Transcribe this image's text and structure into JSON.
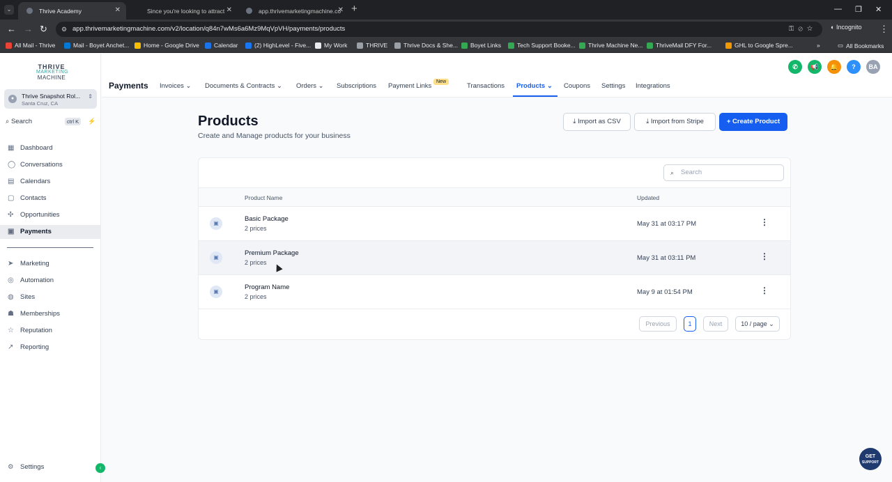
{
  "browser": {
    "tabs": [
      {
        "label": "Thrive Academy"
      },
      {
        "label": "Since you're looking to attract"
      },
      {
        "label": "app.thrivemarketingmachine.co"
      }
    ],
    "new_tab": "+",
    "url": "app.thrivemarketingmachine.com/v2/location/q84n7wMs6a6Mz9MqVpVH/payments/products",
    "incognito_label": "Incognito",
    "bookmarks": [
      {
        "label": "All Mail - Thrive",
        "color": "#ea4335"
      },
      {
        "label": "Mail - Boyet Anchet...",
        "color": "#0078d4"
      },
      {
        "label": "Home - Google Drive",
        "color": "#fbbc04"
      },
      {
        "label": "Calendar",
        "color": "#1a73e8"
      },
      {
        "label": "(2) HighLevel - Five...",
        "color": "#1877f2"
      },
      {
        "label": "My Work",
        "color": "#e8eaed"
      },
      {
        "label": "THRIVE",
        "color": "#9aa0a6"
      },
      {
        "label": "Thrive Docs & She...",
        "color": "#9aa0a6"
      },
      {
        "label": "Boyet Links",
        "color": "#34a853"
      },
      {
        "label": "Tech Support Booke...",
        "color": "#34a853"
      },
      {
        "label": "Thrive Machine Ne...",
        "color": "#34a853"
      },
      {
        "label": "ThriveMail DFY For...",
        "color": "#34a853"
      },
      {
        "label": "GHL to Google Spre...",
        "color": "#f29900"
      }
    ],
    "all_bookmarks": "All Bookmarks"
  },
  "sidebar": {
    "logo": {
      "line1": "THRIVE",
      "line2": "MARKETING",
      "line3": "MACHINE"
    },
    "account": {
      "name": "Thrive Snapshot Rol...",
      "location": "Santa Cruz, CA"
    },
    "search": {
      "label": "Search",
      "shortcut": "ctrl K"
    },
    "items": [
      {
        "label": "Dashboard",
        "icon": "dashboard-icon"
      },
      {
        "label": "Conversations",
        "icon": "chat-icon"
      },
      {
        "label": "Calendars",
        "icon": "calendar-icon"
      },
      {
        "label": "Contacts",
        "icon": "contacts-icon"
      },
      {
        "label": "Opportunities",
        "icon": "opportunities-icon"
      },
      {
        "label": "Payments",
        "icon": "payments-icon"
      },
      {
        "label": "Marketing",
        "icon": "send-icon"
      },
      {
        "label": "Automation",
        "icon": "automation-icon"
      },
      {
        "label": "Sites",
        "icon": "globe-icon"
      },
      {
        "label": "Memberships",
        "icon": "memberships-icon"
      },
      {
        "label": "Reputation",
        "icon": "star-icon"
      },
      {
        "label": "Reporting",
        "icon": "trend-icon"
      }
    ],
    "settings": "Settings"
  },
  "topnav": {
    "title": "Payments",
    "items": [
      {
        "label": "Invoices"
      },
      {
        "label": "Documents & Contracts"
      },
      {
        "label": "Orders"
      },
      {
        "label": "Subscriptions"
      },
      {
        "label": "Payment Links"
      },
      {
        "label": "Transactions"
      },
      {
        "label": "Products"
      },
      {
        "label": "Coupons"
      },
      {
        "label": "Settings"
      },
      {
        "label": "Integrations"
      }
    ],
    "new_badge": "New",
    "avatar": "BA",
    "help": "?"
  },
  "page": {
    "title": "Products",
    "subtitle": "Create and Manage products for your business",
    "import_csv": "Import as CSV",
    "import_stripe": "Import from Stripe",
    "create": "Create Product",
    "create_plus": "+"
  },
  "table": {
    "search_placeholder": "Search",
    "columns": {
      "name": "Product Name",
      "updated": "Updated"
    },
    "rows": [
      {
        "name": "Basic Package",
        "prices": "2 prices",
        "updated": "May 31 at 03:17 PM"
      },
      {
        "name": "Premium Package",
        "prices": "2 prices",
        "updated": "May 31 at 03:11 PM"
      },
      {
        "name": "Program Name",
        "prices": "2 prices",
        "updated": "May 9 at 01:54 PM"
      }
    ],
    "pagination": {
      "previous": "Previous",
      "page": "1",
      "next": "Next",
      "per_page": "10 / page"
    }
  },
  "support": {
    "line1": "GET",
    "line2": "SUPPORT"
  },
  "colors": {
    "accent": "#155eef",
    "badge": "#fedf89",
    "success": "#12b76a"
  }
}
